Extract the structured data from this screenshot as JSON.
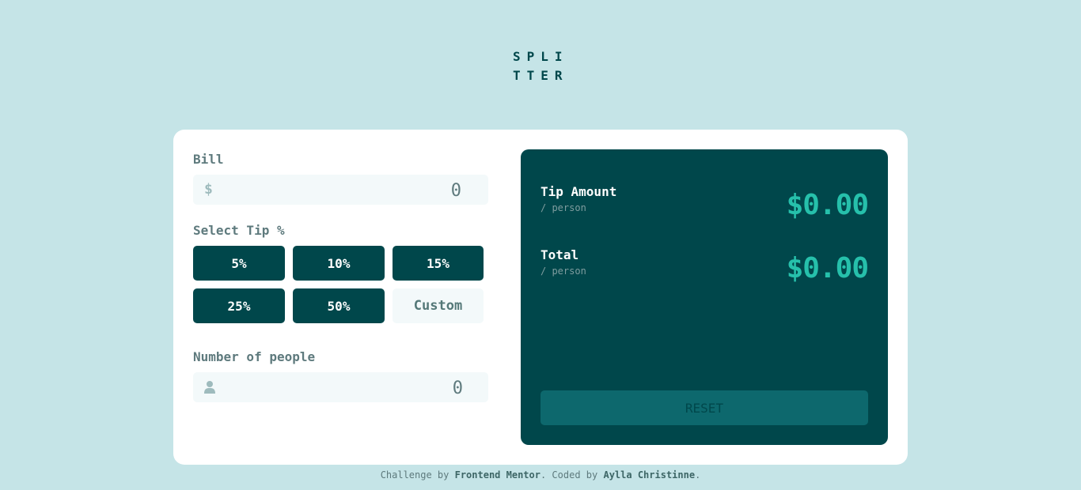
{
  "logo": {
    "line1": "SPLI",
    "line2": "TTER"
  },
  "bill": {
    "label": "Bill",
    "currency_symbol": "$",
    "value": "0"
  },
  "tip": {
    "label": "Select Tip %",
    "options": [
      "5%",
      "10%",
      "15%",
      "25%",
      "50%"
    ],
    "custom_label": "Custom"
  },
  "people": {
    "label": "Number of people",
    "icon": "person-icon",
    "value": "0"
  },
  "results": {
    "tip_amount": {
      "label": "Tip Amount",
      "sub": "/ person",
      "value": "$0.00"
    },
    "total": {
      "label": "Total",
      "sub": "/ person",
      "value": "$0.00"
    },
    "reset_label": "RESET"
  },
  "footer": {
    "prefix": "Challenge by ",
    "challenge_by": "Frontend Mentor",
    "middle": ". Coded by ",
    "coded_by": "Aylla Christinne",
    "suffix": "."
  },
  "colors": {
    "background": "#c5e4e7",
    "dark_cyan": "#00474b",
    "accent": "#26c0ab",
    "input_bg": "#f3f9fa"
  }
}
